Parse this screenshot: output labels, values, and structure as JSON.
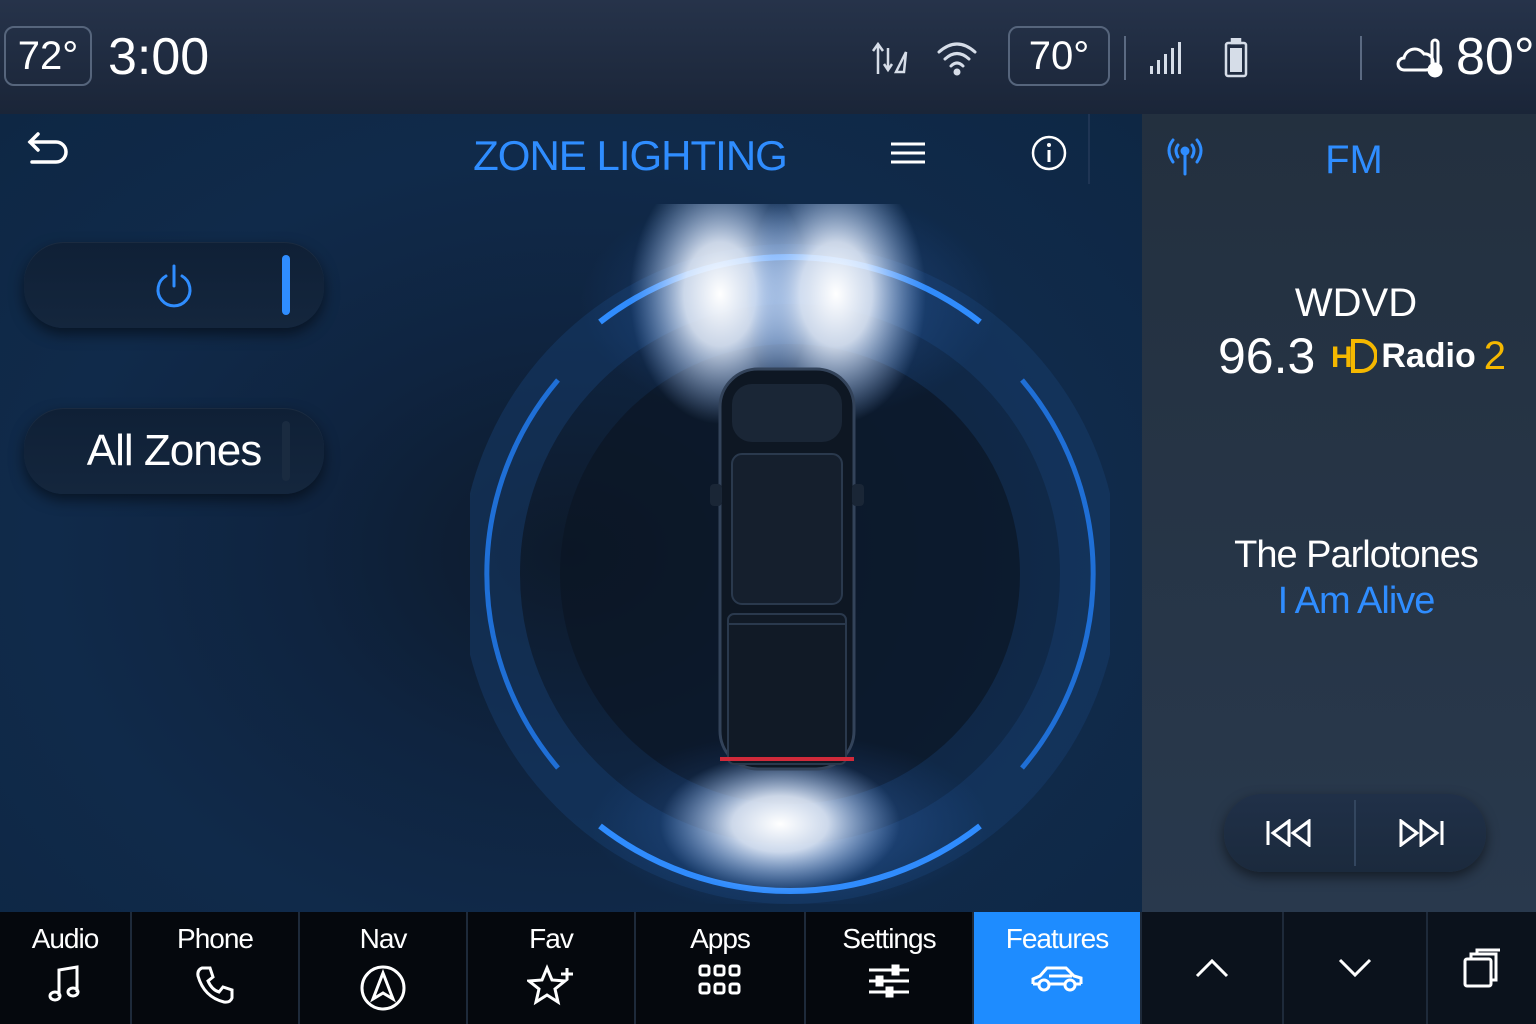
{
  "status_bar": {
    "cabin_temp_left": "72°",
    "time": "3:00",
    "cabin_temp_right": "70°",
    "outside_temp": "80°",
    "icons": [
      "navigation-arrows-icon",
      "wifi-icon",
      "signal-strength-icon",
      "battery-icon",
      "weather-cloud-thermometer-icon"
    ]
  },
  "zone_lighting": {
    "title": "ZONE LIGHTING",
    "back_icon": "back-arrow-icon",
    "menu_icon": "hamburger-menu-icon",
    "info_icon": "info-icon",
    "power_icon": "power-icon",
    "all_zones_label": "All Zones",
    "accent_color": "#2f8dff"
  },
  "radio": {
    "band": "FM",
    "station": "WDVD",
    "frequency": "96.3",
    "hd_label": "Radio",
    "hd_channel": "2",
    "artist": "The Parlotones",
    "song": "I Am Alive",
    "prev_icon": "seek-back-icon",
    "next_icon": "seek-forward-icon"
  },
  "nav": {
    "items": [
      {
        "label": "Audio",
        "icon": "music-note-icon"
      },
      {
        "label": "Phone",
        "icon": "phone-icon"
      },
      {
        "label": "Nav",
        "icon": "navigation-icon"
      },
      {
        "label": "Fav",
        "icon": "star-plus-icon"
      },
      {
        "label": "Apps",
        "icon": "apps-grid-icon"
      },
      {
        "label": "Settings",
        "icon": "sliders-icon"
      },
      {
        "label": "Features",
        "icon": "car-icon",
        "active": true
      }
    ],
    "up_icon": "chevron-up-icon",
    "down_icon": "chevron-down-icon",
    "windows_icon": "stacked-windows-icon",
    "active_color": "#1e8cff"
  }
}
